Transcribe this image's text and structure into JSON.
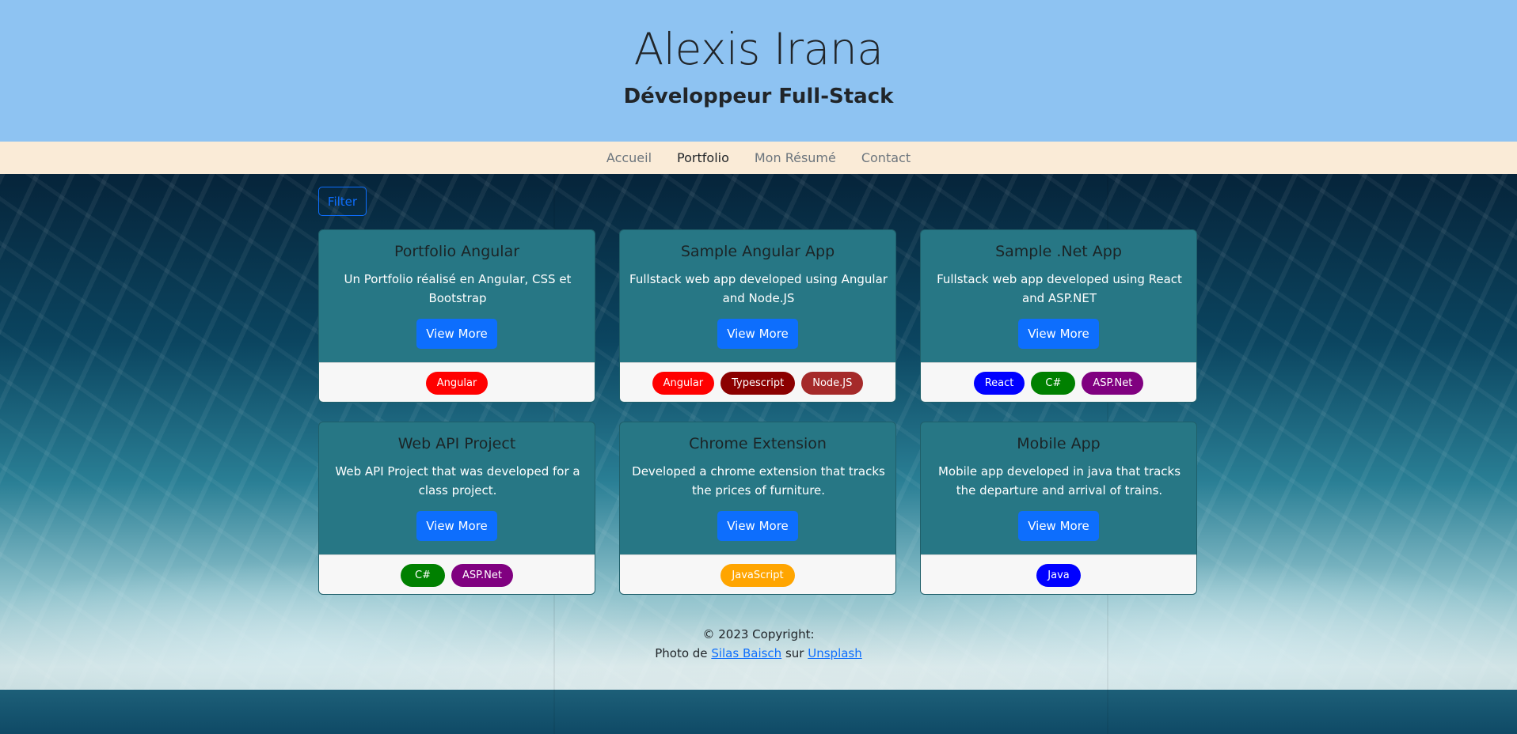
{
  "header": {
    "title": "Alexis Irana",
    "subtitle": "Développeur Full-Stack"
  },
  "nav": {
    "items": [
      "Accueil",
      "Portfolio",
      "Mon Résumé",
      "Contact"
    ],
    "active": "Portfolio"
  },
  "filter_label": "Filter",
  "cards": [
    {
      "title": "Portfolio Angular",
      "text": "Un Portfolio réalisé en Angular, CSS et Bootstrap",
      "button": "View More",
      "tags": [
        {
          "label": "Angular",
          "color": "#ff0000"
        }
      ]
    },
    {
      "title": "Sample Angular App",
      "text": "Fullstack web app developed using Angular and Node.JS",
      "button": "View More",
      "tags": [
        {
          "label": "Angular",
          "color": "#ff0000"
        },
        {
          "label": "Typescript",
          "color": "#8b0000"
        },
        {
          "label": "Node.JS",
          "color": "#a52a2a"
        }
      ]
    },
    {
      "title": "Sample .Net App",
      "text": "Fullstack web app developed using React and ASP.NET",
      "button": "View More",
      "tags": [
        {
          "label": "React",
          "color": "#0000ff"
        },
        {
          "label": "C#",
          "color": "#008000"
        },
        {
          "label": "ASP.Net",
          "color": "#800080"
        }
      ]
    },
    {
      "title": "Web API Project",
      "text": "Web API Project that was developed for a class project.",
      "button": "View More",
      "tags": [
        {
          "label": "C#",
          "color": "#008000"
        },
        {
          "label": "ASP.Net",
          "color": "#800080"
        }
      ]
    },
    {
      "title": "Chrome Extension",
      "text": "Developed a chrome extension that tracks the prices of furniture.",
      "button": "View More",
      "tags": [
        {
          "label": "JavaScript",
          "color": "#ffa500"
        }
      ]
    },
    {
      "title": "Mobile App",
      "text": "Mobile app developed in java that tracks the departure and arrival of trains.",
      "button": "View More",
      "tags": [
        {
          "label": "Java",
          "color": "#0000ff"
        }
      ]
    }
  ],
  "footer": {
    "copyright": "© 2023 Copyright:",
    "photo_prefix": "Photo de",
    "photographer": "Silas Baisch",
    "middle": "sur",
    "site": "Unsplash"
  },
  "colors": {
    "header_bg": "#8ec3f2",
    "nav_bg": "#faebd7",
    "card_bg": "#277785",
    "primary": "#0d6efd"
  }
}
